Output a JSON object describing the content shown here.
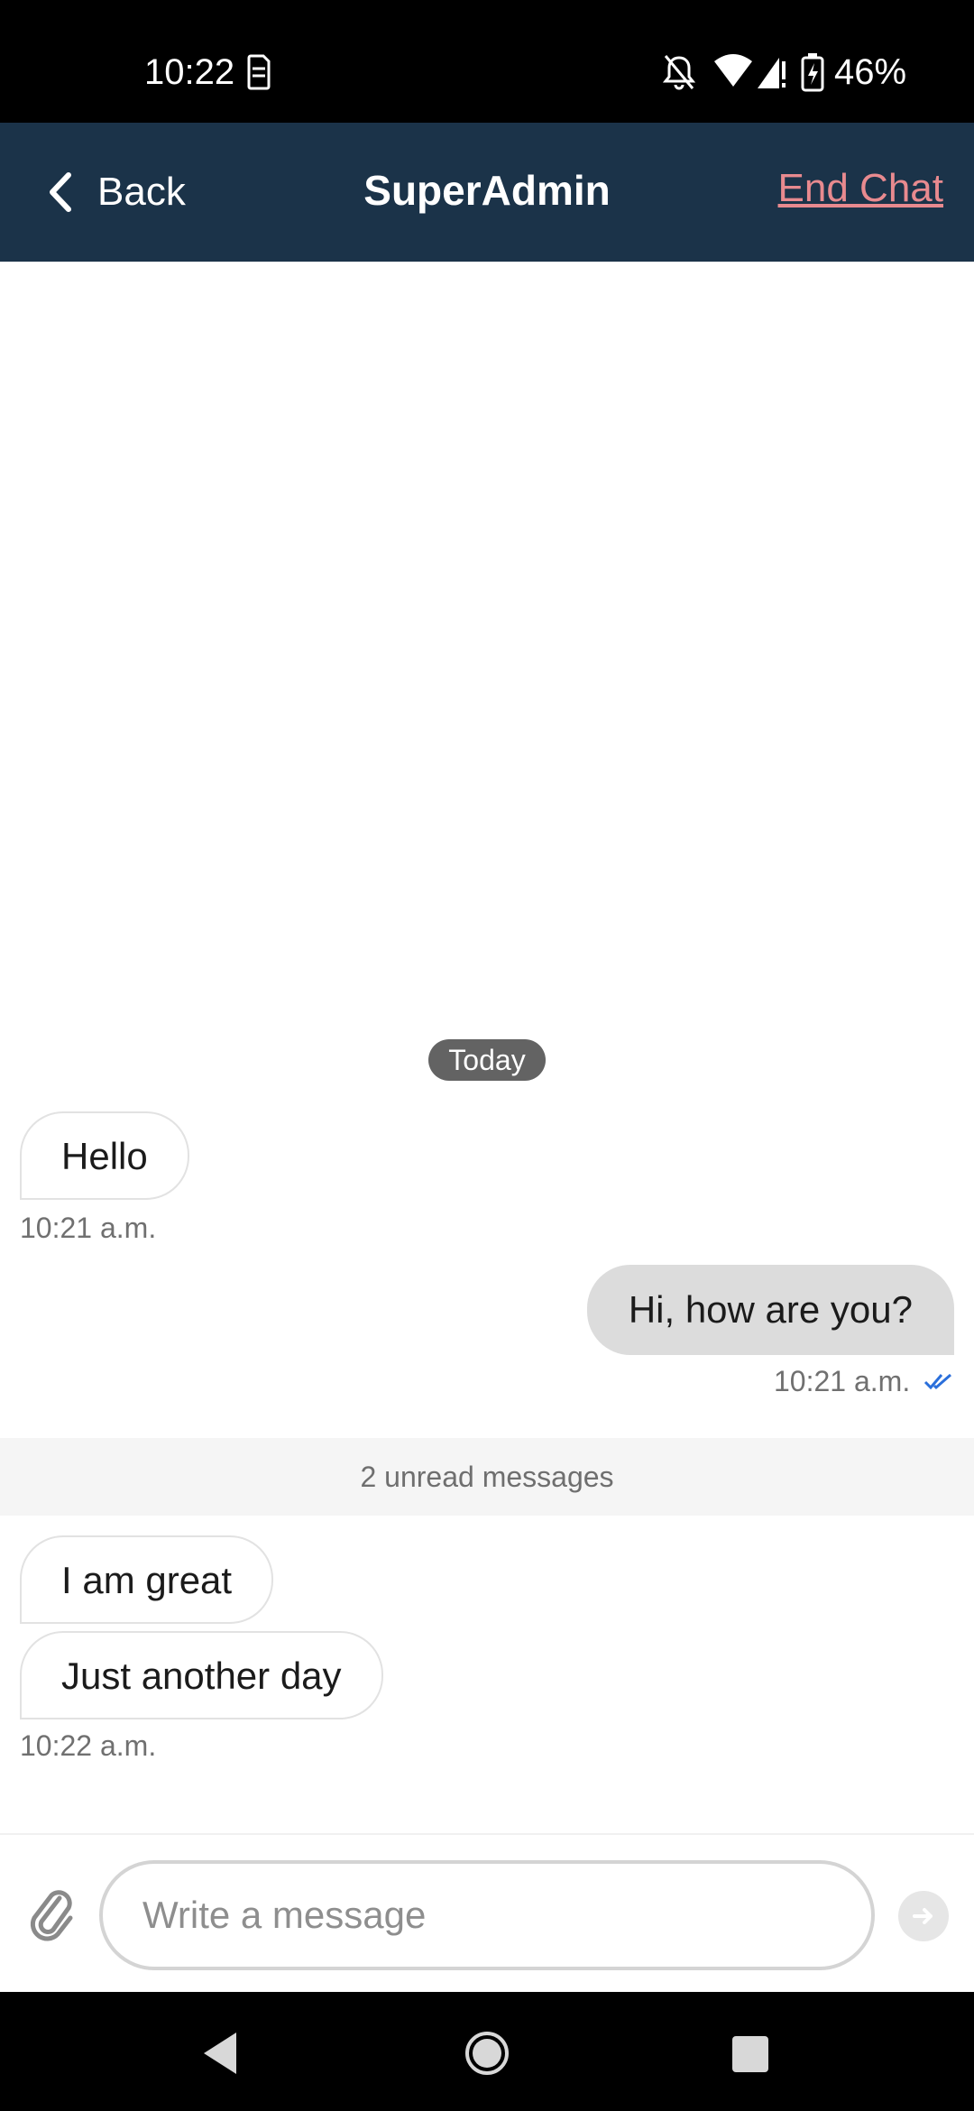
{
  "status_bar": {
    "time": "10:22",
    "battery": "46%",
    "icons": [
      "sim-alert-icon",
      "notifications-off-icon",
      "wifi-icon",
      "signal-alert-icon",
      "battery-charging-icon"
    ]
  },
  "header": {
    "back_label": "Back",
    "title": "SuperAdmin",
    "end_chat_label": "End Chat",
    "background": "#1b3349",
    "end_chat_color": "#e88a8f"
  },
  "chat": {
    "date_label": "Today",
    "messages": [
      {
        "direction": "incoming",
        "text": "Hello"
      },
      {
        "direction": "outgoing",
        "text": "Hi, how are you?"
      },
      {
        "direction": "incoming",
        "text": "I am great"
      },
      {
        "direction": "incoming",
        "text": "Just another day"
      }
    ],
    "timestamps": {
      "first_incoming": "10:21 a.m.",
      "outgoing": "10:21 a.m.",
      "last_incoming": "10:22 a.m."
    },
    "unread_banner": "2 unread messages"
  },
  "composer": {
    "placeholder": "Write a message",
    "value": ""
  }
}
